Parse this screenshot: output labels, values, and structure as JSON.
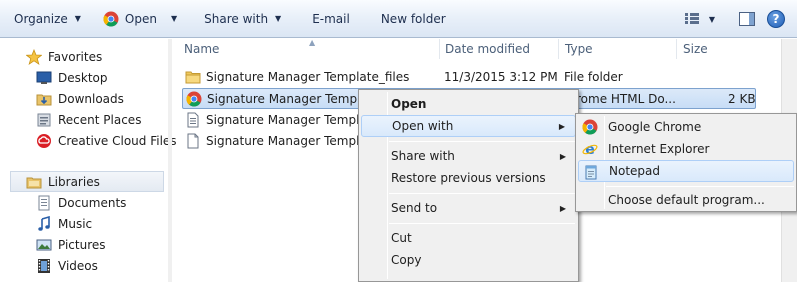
{
  "toolbar": {
    "organize": "Organize",
    "open": "Open",
    "share_with": "Share with",
    "email": "E-mail",
    "new_folder": "New folder"
  },
  "nav": {
    "favorites": "Favorites",
    "desktop": "Desktop",
    "downloads": "Downloads",
    "recent_places": "Recent Places",
    "creative_cloud": "Creative Cloud Files",
    "libraries": "Libraries",
    "documents": "Documents",
    "music": "Music",
    "pictures": "Pictures",
    "videos": "Videos"
  },
  "columns": {
    "name": "Name",
    "date": "Date modified",
    "type": "Type",
    "size": "Size"
  },
  "files": [
    {
      "name": "Signature Manager Template_files",
      "date": "11/3/2015 3:12 PM",
      "type": "File folder",
      "size": ""
    },
    {
      "name": "Signature Manager Template",
      "date": "",
      "type": "rome HTML Do...",
      "size": "2 KB"
    },
    {
      "name": "Signature Manager Template",
      "date": "",
      "type": "",
      "size": ""
    },
    {
      "name": "Signature Manager Template",
      "date": "",
      "type": "",
      "size": ""
    }
  ],
  "context_menu": {
    "open": "Open",
    "open_with": "Open with",
    "share_with": "Share with",
    "restore": "Restore previous versions",
    "send_to": "Send to",
    "cut": "Cut",
    "copy": "Copy"
  },
  "open_with_menu": {
    "chrome": "Google Chrome",
    "ie": "Internet Explorer",
    "notepad": "Notepad",
    "choose": "Choose default program..."
  },
  "colors": {
    "selection_fill": "#c7ddf6",
    "selection_border": "#7da2ce",
    "menu_bg": "#f0f0f0",
    "accent": "#1e2f4f"
  }
}
